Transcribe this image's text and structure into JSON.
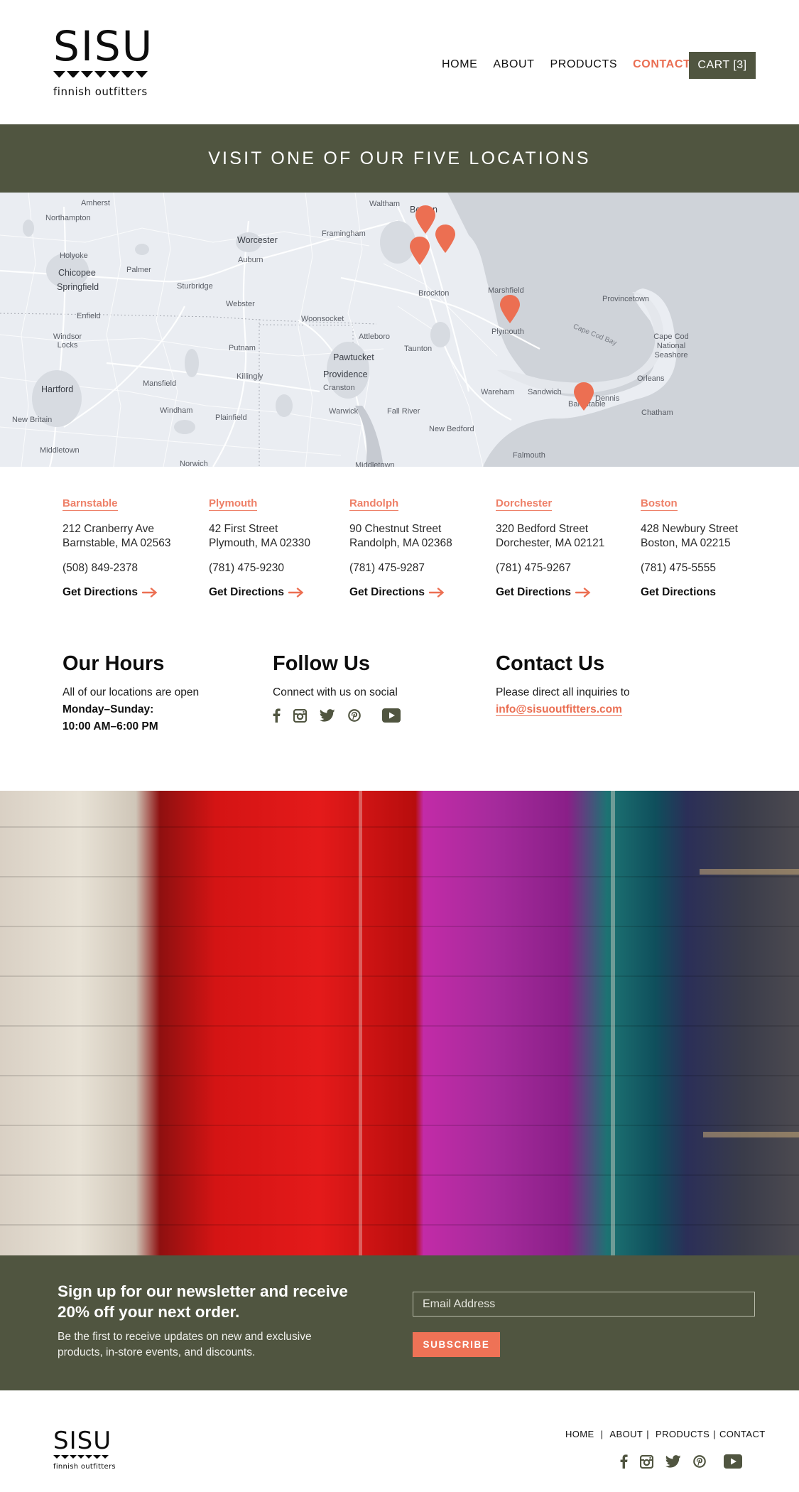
{
  "header": {
    "logo": {
      "wordmark": "SISU",
      "tagline": "finnish outfitters"
    },
    "nav": [
      {
        "label": "HOME",
        "active": false
      },
      {
        "label": "ABOUT",
        "active": false
      },
      {
        "label": "PRODUCTS",
        "active": false
      },
      {
        "label": "CONTACT",
        "active": true
      }
    ],
    "cart_label": "CART [3]"
  },
  "banner": {
    "title": "VISIT ONE OF OUR FIVE LOCATIONS"
  },
  "map": {
    "labels": [
      "Amherst",
      "Northampton",
      "Holyoke",
      "Chicopee",
      "Springfield",
      "Enfield",
      "Windsor Locks",
      "Hartford",
      "New Britain",
      "Middletown",
      "Palmer",
      "Sturbridge",
      "Worcester",
      "Auburn",
      "Webster",
      "Putnam",
      "Killingly",
      "Mansfield",
      "Windham",
      "Plainfield",
      "Norwich",
      "Framingham",
      "Waltham",
      "Boston",
      "Woonsocket",
      "Attleboro",
      "Pawtucket",
      "Providence",
      "Cranston",
      "Warwick",
      "Fall River",
      "Brockton",
      "Taunton",
      "Marshfield",
      "Plymouth",
      "Wareham",
      "Sandwich",
      "Barnstable",
      "Dennis",
      "Chatham",
      "Orleans",
      "Cape Cod National Seashore",
      "Provincetown",
      "Cape Cod Bay",
      "New Bedford",
      "Falmouth",
      "Middletown"
    ],
    "pins": [
      "Boston",
      "Dorchester",
      "Randolph",
      "Plymouth",
      "Barnstable"
    ]
  },
  "locations": [
    {
      "name": "Barnstable",
      "street": "212 Cranberry Ave",
      "city": "Barnstable, MA 02563",
      "phone": "(508) 849-2378",
      "directions": "Get Directions",
      "arrow": true
    },
    {
      "name": "Plymouth",
      "street": "42 First Street",
      "city": "Plymouth, MA 02330",
      "phone": "(781) 475-9230",
      "directions": "Get Directions",
      "arrow": true
    },
    {
      "name": "Randolph",
      "street": "90 Chestnut Street",
      "city": "Randolph, MA 02368",
      "phone": "(781) 475-9287",
      "directions": "Get Directions",
      "arrow": true
    },
    {
      "name": "Dorchester",
      "street": "320 Bedford Street",
      "city": "Dorchester, MA 02121",
      "phone": "(781) 475-9267",
      "directions": "Get Directions",
      "arrow": true
    },
    {
      "name": "Boston",
      "street": "428 Newbury Street",
      "city": "Boston, MA 02215",
      "phone": "(781) 475-5555",
      "directions": "Get Directions",
      "arrow": false
    }
  ],
  "hours": {
    "title": "Our Hours",
    "intro": "All of our locations are open",
    "days": "Monday–Sunday:",
    "time": "10:00 AM–6:00 PM"
  },
  "follow": {
    "title": "Follow Us",
    "intro": "Connect with us on social",
    "icons": [
      "facebook-icon",
      "instagram-icon",
      "twitter-icon",
      "pinterest-icon",
      "youtube-icon"
    ]
  },
  "contact": {
    "title": "Contact Us",
    "intro": "Please direct all inquiries to",
    "email": "info@sisuoutfitters.com"
  },
  "newsletter": {
    "title": "Sign up for our newsletter and receive 20% off your next order.",
    "description": "Be the first to receive updates on new and exclusive products, in-store events, and discounts.",
    "email_placeholder": "Email Address",
    "subscribe_label": "SUBSCRIBE"
  },
  "footer": {
    "logo": {
      "wordmark": "SISU",
      "tagline": "finnish outfitters"
    },
    "nav": [
      "HOME",
      "ABOUT",
      "PRODUCTS",
      "CONTACT"
    ]
  },
  "colors": {
    "olive": "#505540",
    "coral": "#ea6e52",
    "text": "#111111"
  }
}
